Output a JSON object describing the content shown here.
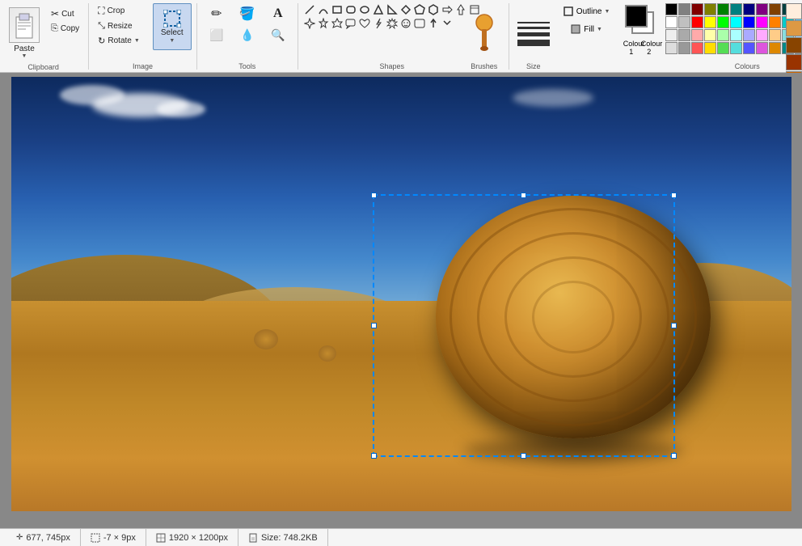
{
  "ribbon": {
    "groups": {
      "clipboard": {
        "label": "Clipboard",
        "paste_label": "Paste",
        "cut_label": "Cut",
        "copy_label": "Copy"
      },
      "image": {
        "label": "Image",
        "crop_label": "Crop",
        "resize_label": "Resize",
        "rotate_label": "Rotate",
        "select_label": "Select"
      },
      "tools": {
        "label": "Tools"
      },
      "shapes": {
        "label": "Shapes"
      },
      "brushes": {
        "label": "Brushes",
        "brushes_label": "Brushes"
      },
      "size": {
        "label": "Size",
        "size_label": "Size"
      },
      "outline_fill": {
        "outline_label": "Outline",
        "fill_label": "Fill"
      },
      "colours": {
        "label": "Colours",
        "colour1_label": "Colour\n1",
        "colour2_label": "Colour\n2"
      }
    }
  },
  "status": {
    "coordinates": "677, 745px",
    "selection": "-7 × 9px",
    "image_size": "1920 × 1200px",
    "file_size": "Size: 748.2KB"
  },
  "colours": {
    "palette": [
      [
        "#000000",
        "#808080",
        "#800000",
        "#808000",
        "#008000",
        "#008080",
        "#000080",
        "#800080",
        "#804000",
        "#004040",
        "#0000ff",
        "#006600",
        "#660000",
        "#993300",
        "#336600",
        "#003366"
      ],
      [
        "#ffffff",
        "#c0c0c0",
        "#ff0000",
        "#ffff00",
        "#00ff00",
        "#00ffff",
        "#0000ff",
        "#ff00ff",
        "#ff8000",
        "#00cccc",
        "#66ccff",
        "#00cc00",
        "#cc6600",
        "#ff6600",
        "#99cc00",
        "#3399ff"
      ],
      [
        "#eeeeee",
        "#aaaaaa",
        "#ffaaaa",
        "#ffffaa",
        "#aaffaa",
        "#aaffff",
        "#aaaaff",
        "#ffaaff",
        "#ffcc88",
        "#88dddd",
        "#aaddff",
        "#88ff88",
        "#ffbb88",
        "#ffaa88",
        "#ccff88",
        "#88bbff"
      ],
      [
        "#dddddd",
        "#999999",
        "#ff5555",
        "#ffdd00",
        "#55dd55",
        "#55dddd",
        "#5555ff",
        "#dd55dd",
        "#dd8800",
        "#008888",
        "#2288cc",
        "#008800",
        "#885500",
        "#cc5500",
        "#668800",
        "#005599"
      ]
    ],
    "extra_colours": [
      "#ffeedd",
      "#dd9944",
      "#884400",
      "#993300",
      "#cc6600",
      "#ffaa44",
      "#eebb66",
      "#ddcc88",
      "#ccbb44",
      "#99aa33",
      "#ffcc00",
      "#ff9900",
      "#cc8833",
      "#aa7722",
      "#886611",
      "#664400"
    ],
    "colour1": "#000000",
    "colour2": "#ffffff"
  }
}
